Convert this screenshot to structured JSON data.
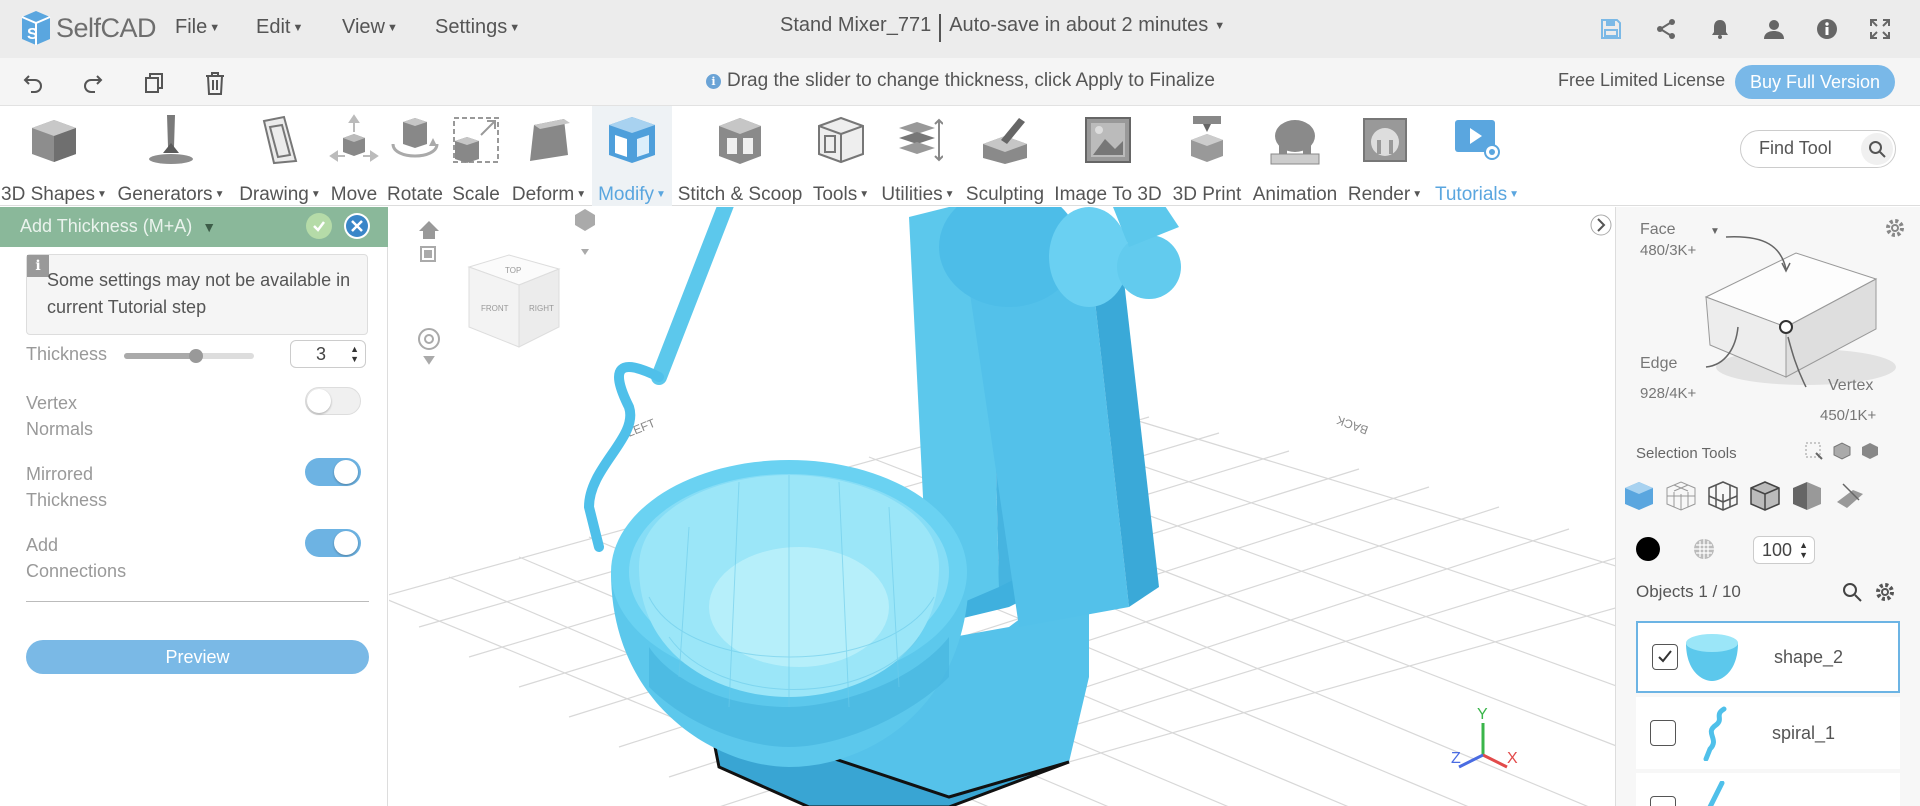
{
  "app": {
    "logo_text": "SelfCAD"
  },
  "menu": {
    "file": "File",
    "edit": "Edit",
    "view": "View",
    "settings": "Settings"
  },
  "document": {
    "title": "Stand Mixer_771",
    "autosave": "Auto-save in about 2 minutes"
  },
  "hint": "Drag the slider to change thickness, click Apply to Finalize",
  "license": {
    "text": "Free Limited License",
    "buy_label": "Buy Full Version"
  },
  "toolbar": {
    "items": [
      {
        "label": "3D Shapes",
        "dropdown": true
      },
      {
        "label": "Generators",
        "dropdown": true
      },
      {
        "label": "Drawing",
        "dropdown": true
      },
      {
        "label": "Move",
        "dropdown": false
      },
      {
        "label": "Rotate",
        "dropdown": false
      },
      {
        "label": "Scale",
        "dropdown": false
      },
      {
        "label": "Deform",
        "dropdown": true
      },
      {
        "label": "Modify",
        "dropdown": true
      },
      {
        "label": "Stitch & Scoop",
        "dropdown": false
      },
      {
        "label": "Tools",
        "dropdown": true
      },
      {
        "label": "Utilities",
        "dropdown": true
      },
      {
        "label": "Sculpting",
        "dropdown": false
      },
      {
        "label": "Image To 3D",
        "dropdown": false
      },
      {
        "label": "3D Print",
        "dropdown": false
      },
      {
        "label": "Animation",
        "dropdown": false
      },
      {
        "label": "Render",
        "dropdown": true
      },
      {
        "label": "Tutorials",
        "dropdown": true
      }
    ],
    "find_placeholder": "Find Tool"
  },
  "panel": {
    "title": "Add Thickness (M+A)",
    "notice": "Some settings may not be available in current Tutorial step",
    "thickness_label": "Thickness",
    "thickness_value": "3",
    "thickness_slider_fraction": 0.55,
    "vertex_normals_label": "Vertex Normals",
    "vertex_normals_on": false,
    "mirrored_label": "Mirrored Thickness",
    "mirrored_on": true,
    "connections_label": "Add Connections",
    "connections_on": true,
    "preview_label": "Preview"
  },
  "viewport": {
    "grid_labels": [
      "LEFT",
      "BACK"
    ],
    "nav_cube_faces": [
      "TOP",
      "FRONT",
      "RIGHT"
    ],
    "axis": {
      "x": "X",
      "y": "Y",
      "z": "Z"
    }
  },
  "selection": {
    "mode": "Face",
    "face_count": "480/3K+",
    "edge_label": "Edge",
    "edge_count": "928/4K+",
    "vertex_label": "Vertex",
    "vertex_count": "450/1K+",
    "tools_label": "Selection Tools",
    "opacity_value": "100"
  },
  "objects": {
    "header": "Objects 1 / 10",
    "items": [
      {
        "name": "shape_2",
        "checked": true
      },
      {
        "name": "spiral_1",
        "checked": false
      }
    ]
  },
  "colors": {
    "accent": "#5aa6df",
    "model": "#5cc8ec",
    "panel_header": "#8ab89a"
  }
}
